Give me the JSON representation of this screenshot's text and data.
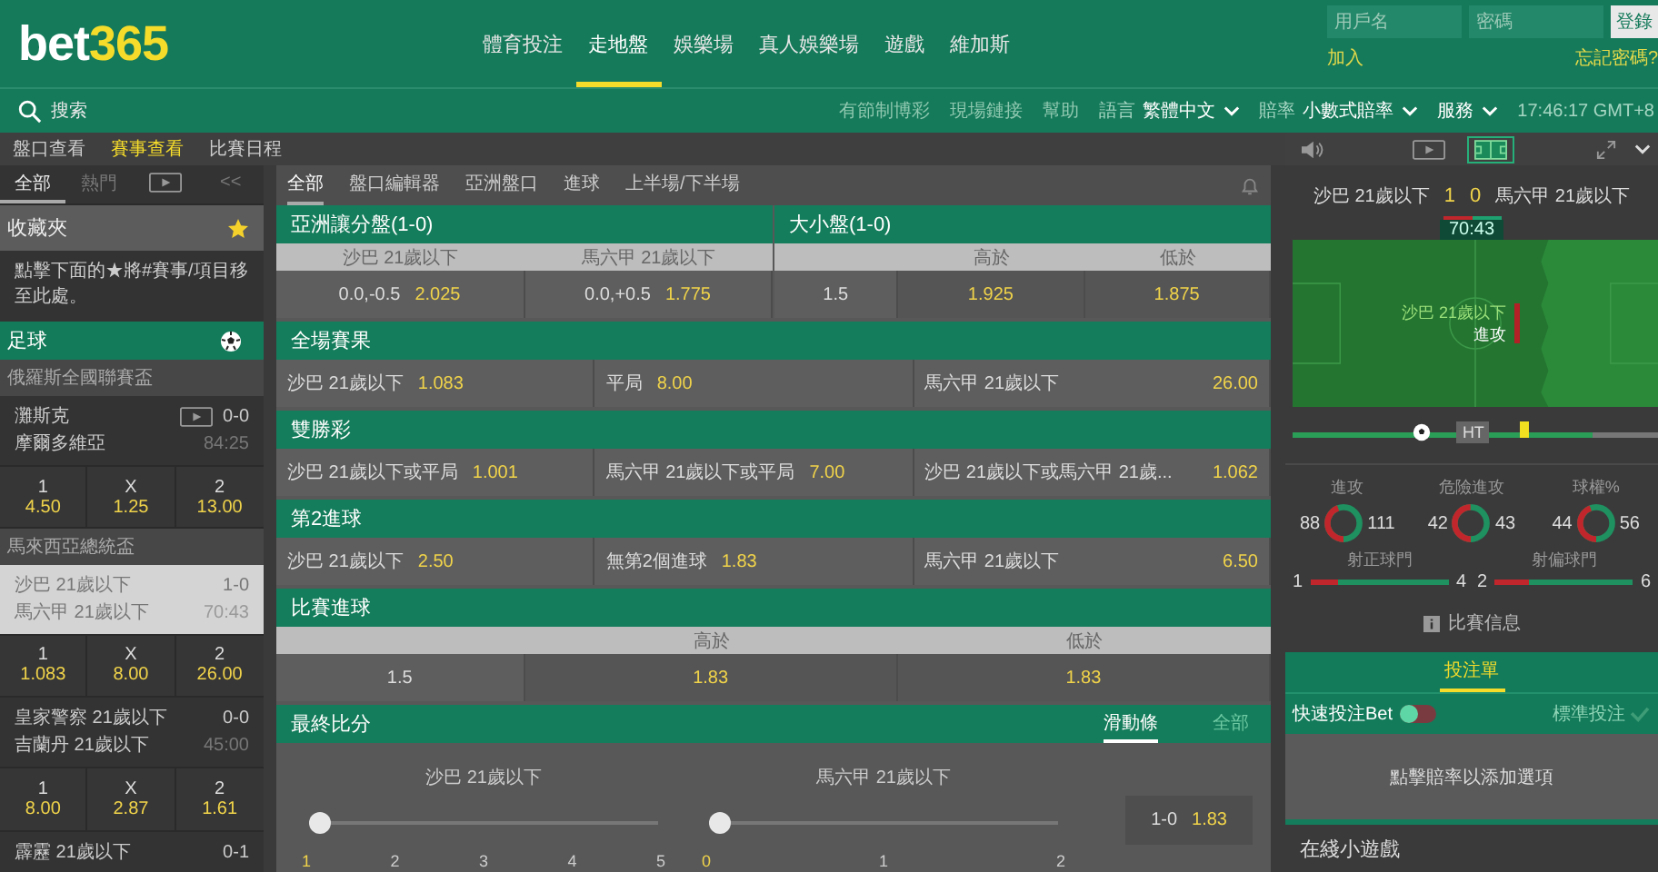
{
  "header": {
    "logo": {
      "text": "bet",
      "accent": "365"
    },
    "nav": [
      {
        "label": "體育投注",
        "selected": false
      },
      {
        "label": "走地盤",
        "selected": true
      },
      {
        "label": "娛樂場",
        "selected": false
      },
      {
        "label": "真人娛樂場",
        "selected": false
      },
      {
        "label": "遊戲",
        "selected": false
      },
      {
        "label": "維加斯",
        "selected": false
      }
    ],
    "login": {
      "username": {
        "placeholder": "用戶名"
      },
      "password": {
        "placeholder": "密碼"
      },
      "button": "登錄",
      "join": "加入",
      "forgot": "忘記密碼?"
    }
  },
  "toolbar": {
    "search": {
      "placeholder": "搜索"
    },
    "links": [
      "有節制博彩",
      "現場鏈接",
      "幫助"
    ],
    "language": {
      "label": "語言",
      "value": "繁體中文"
    },
    "odds_format": {
      "label": "賠率",
      "value": "小數式賠率"
    },
    "services": "服務",
    "clock": "17:46:17 GMT+8"
  },
  "subnav": {
    "tabs": [
      {
        "label": "盤口查看",
        "selected": false
      },
      {
        "label": "賽事查看",
        "selected": true
      },
      {
        "label": "比賽日程",
        "selected": false
      }
    ],
    "media_tabs": [
      {
        "kind": "video",
        "selected": false
      },
      {
        "kind": "pitch",
        "selected": true
      }
    ]
  },
  "sidebar": {
    "tabs": [
      {
        "kind": "text",
        "label": "全部",
        "selected": true
      },
      {
        "kind": "text",
        "label": "熱門",
        "selected": false
      },
      {
        "kind": "video",
        "selected": false
      },
      {
        "kind": "text",
        "label": "<<",
        "selected": false
      }
    ],
    "favourites": {
      "title": "收藏夾",
      "hint": "點擊下面的★將#賽事/項目移至此處。"
    },
    "sport": "足球",
    "leagues": [
      {
        "name": "俄羅斯全國聯賽盃",
        "matches": [
          {
            "home": "灘斯克",
            "away": "摩爾多維亞",
            "score": "0-0",
            "time": "84:25",
            "video": true,
            "selected": false,
            "odds": [
              {
                "label": "1",
                "price": "4.50"
              },
              {
                "label": "X",
                "price": "1.25"
              },
              {
                "label": "2",
                "price": "13.00"
              }
            ]
          }
        ]
      },
      {
        "name": "馬來西亞總統盃",
        "matches": [
          {
            "home": "沙巴 21歲以下",
            "away": "馬六甲 21歲以下",
            "score": "1-0",
            "time": "70:43",
            "video": false,
            "selected": true,
            "odds": [
              {
                "label": "1",
                "price": "1.083"
              },
              {
                "label": "X",
                "price": "8.00"
              },
              {
                "label": "2",
                "price": "26.00"
              }
            ]
          },
          {
            "home": "皇家警察 21歲以下",
            "away": "吉蘭丹 21歲以下",
            "score": "0-0",
            "time": "45:00",
            "video": false,
            "selected": false,
            "odds": [
              {
                "label": "1",
                "price": "8.00"
              },
              {
                "label": "X",
                "price": "2.87"
              },
              {
                "label": "2",
                "price": "1.61"
              }
            ]
          },
          {
            "home": "霹靂 21歲以下",
            "score": "0-1",
            "video": false,
            "selected": false
          }
        ]
      }
    ]
  },
  "market_tabs": [
    {
      "label": "全部",
      "selected": true
    },
    {
      "label": "盤口編輯器",
      "selected": false
    },
    {
      "label": "亞洲盤口",
      "selected": false
    },
    {
      "label": "進球",
      "selected": false
    },
    {
      "label": "上半場/下半場",
      "selected": false
    }
  ],
  "markets": [
    {
      "kind": "dual",
      "panels": [
        {
          "kind": "handicap",
          "title": "亞洲讓分盤(1-0)",
          "headers": [
            "沙巴 21歲以下",
            "馬六甲 21歲以下"
          ],
          "cells": [
            {
              "line": "0.0,-0.5",
              "price": "2.025"
            },
            {
              "line": "0.0,+0.5",
              "price": "1.775"
            }
          ]
        },
        {
          "kind": "total",
          "title": "大小盤(1-0)",
          "line": "1.5",
          "headers": [
            "高於",
            "低於"
          ],
          "prices": [
            "1.925",
            "1.875"
          ]
        }
      ]
    },
    {
      "kind": "three_way",
      "title": "全場賽果",
      "selections": [
        {
          "name": "沙巴 21歲以下",
          "price": "1.083"
        },
        {
          "name": "平局",
          "price": "8.00"
        },
        {
          "name": "馬六甲 21歲以下",
          "price": "26.00"
        }
      ]
    },
    {
      "kind": "three_way",
      "title": "雙勝彩",
      "selections": [
        {
          "name": "沙巴 21歲以下或平局",
          "price": "1.001"
        },
        {
          "name": "馬六甲 21歲以下或平局",
          "price": "7.00"
        },
        {
          "name": "沙巴 21歲以下或馬六甲 21歲...",
          "price": "1.062"
        }
      ]
    },
    {
      "kind": "three_way",
      "title": "第2進球",
      "selections": [
        {
          "name": "沙巴 21歲以下",
          "price": "2.50"
        },
        {
          "name": "無第2個進球",
          "price": "1.83"
        },
        {
          "name": "馬六甲 21歲以下",
          "price": "6.50"
        }
      ]
    },
    {
      "kind": "total",
      "title": "比賽進球",
      "line": "1.5",
      "headers": [
        "高於",
        "低於"
      ],
      "prices": [
        "1.83",
        "1.83"
      ]
    },
    {
      "kind": "correct_score",
      "title": "最終比分",
      "tabs": [
        {
          "label": "滑動條",
          "selected": true
        },
        {
          "label": "全部",
          "selected": false
        }
      ],
      "sliders": [
        {
          "team": "沙巴 21歲以下",
          "level": 0,
          "ticks": [
            {
              "label": "1",
              "selected": true
            },
            {
              "label": "2",
              "selected": false
            },
            {
              "label": "3",
              "selected": false
            },
            {
              "label": "4",
              "selected": false
            },
            {
              "label": "5",
              "selected": false
            }
          ]
        },
        {
          "team": "馬六甲 21歲以下",
          "level": 0,
          "ticks": [
            {
              "label": "0",
              "selected": true
            },
            {
              "label": "1",
              "selected": false
            },
            {
              "label": "2",
              "selected": false
            }
          ]
        }
      ],
      "result": {
        "score": "1-0",
        "price": "1.83"
      }
    }
  ],
  "scoreboard": {
    "home": "沙巴 21歲以下",
    "home_score": "1",
    "away_score": "0",
    "away": "馬六甲 21歲以下",
    "clock": "70:43"
  },
  "pitch": {
    "team": "沙巴 21歲以下",
    "action": "進攻"
  },
  "timeline": {
    "level": 0.82,
    "halftime": "HT"
  },
  "stats": [
    {
      "label": "進攻",
      "home": "88",
      "away": "111"
    },
    {
      "label": "危險進攻",
      "home": "42",
      "away": "43"
    },
    {
      "label": "球權%",
      "home": "44",
      "away": "56"
    }
  ],
  "shots": [
    {
      "label": "射正球門",
      "home": "1",
      "away": "4"
    },
    {
      "label": "射偏球門",
      "home": "2",
      "away": "6"
    }
  ],
  "match_info": "比賽信息",
  "betslip": {
    "title": "投注單",
    "quick_bet": {
      "label": "快速投注Bet",
      "on": false
    },
    "standard": "標準投注",
    "empty": "點擊賠率以添加選項"
  },
  "mini_games": "在綫小遊戲"
}
